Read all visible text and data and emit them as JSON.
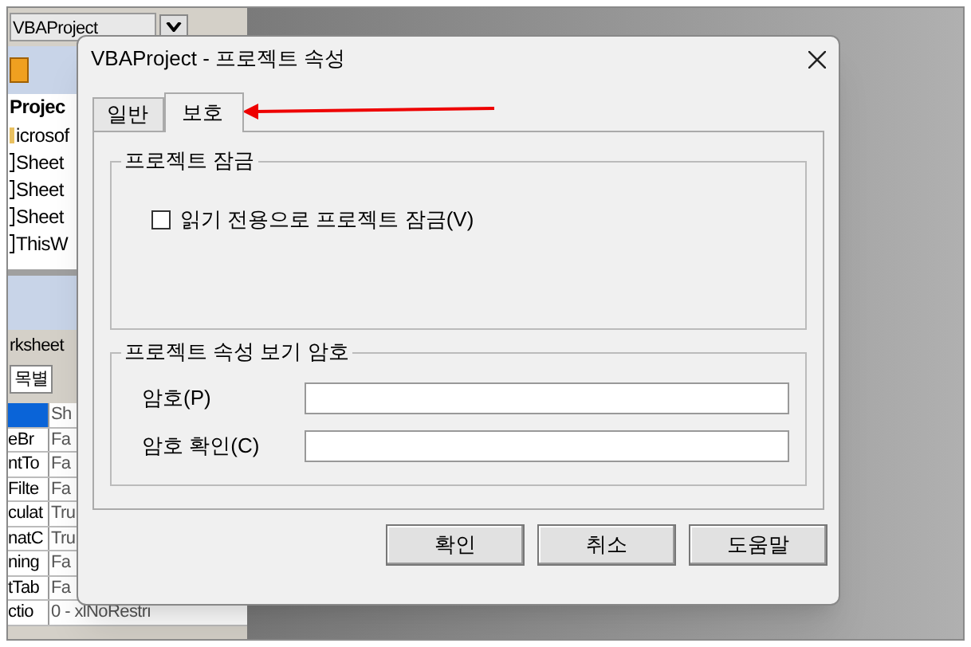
{
  "editor": {
    "project_combo": "VBAProject",
    "project_title": "Projec",
    "tree_items": [
      {
        "label": "icrosof",
        "kind": "folder"
      },
      {
        "label": "Sheet",
        "kind": "sheet"
      },
      {
        "label": "Sheet",
        "kind": "sheet"
      },
      {
        "label": "Sheet",
        "kind": "sheet"
      },
      {
        "label": "ThisW",
        "kind": "sheet"
      }
    ],
    "properties_object": "rksheet",
    "properties_tab": "목별",
    "property_rows": [
      {
        "value": "Sh",
        "selected": true
      },
      {
        "name": "eBr",
        "value": "Fa",
        "selected": false
      },
      {
        "name": "ntTo",
        "value": "Fa",
        "selected": false
      },
      {
        "name": "Filte",
        "value": "Fa",
        "selected": false
      },
      {
        "name": "culat",
        "value": "Tru",
        "selected": false
      },
      {
        "name": "natC",
        "value": "Tru",
        "selected": false
      },
      {
        "name": "ning",
        "value": "Fa",
        "selected": false
      },
      {
        "name": "tTab",
        "value": "Fa",
        "selected": false
      },
      {
        "name": "ctio",
        "value": "0 - xlNoRestri",
        "selected": false
      }
    ]
  },
  "dialog": {
    "title": "VBAProject - 프로젝트 속성",
    "tabs": [
      {
        "label": "일반",
        "selected": false
      },
      {
        "label": "보호",
        "selected": true
      }
    ],
    "lock_group": {
      "title": "프로젝트 잠금",
      "checkbox": {
        "label": "읽기 전용으로 프로젝트 잠금(V)",
        "checked": false
      }
    },
    "password_group": {
      "title": "프로젝트 속성 보기 암호",
      "fields": [
        {
          "label": "암호(P)"
        },
        {
          "label": "암호 확인(C)"
        }
      ]
    },
    "buttons": [
      "확인",
      "취소",
      "도움말"
    ]
  }
}
